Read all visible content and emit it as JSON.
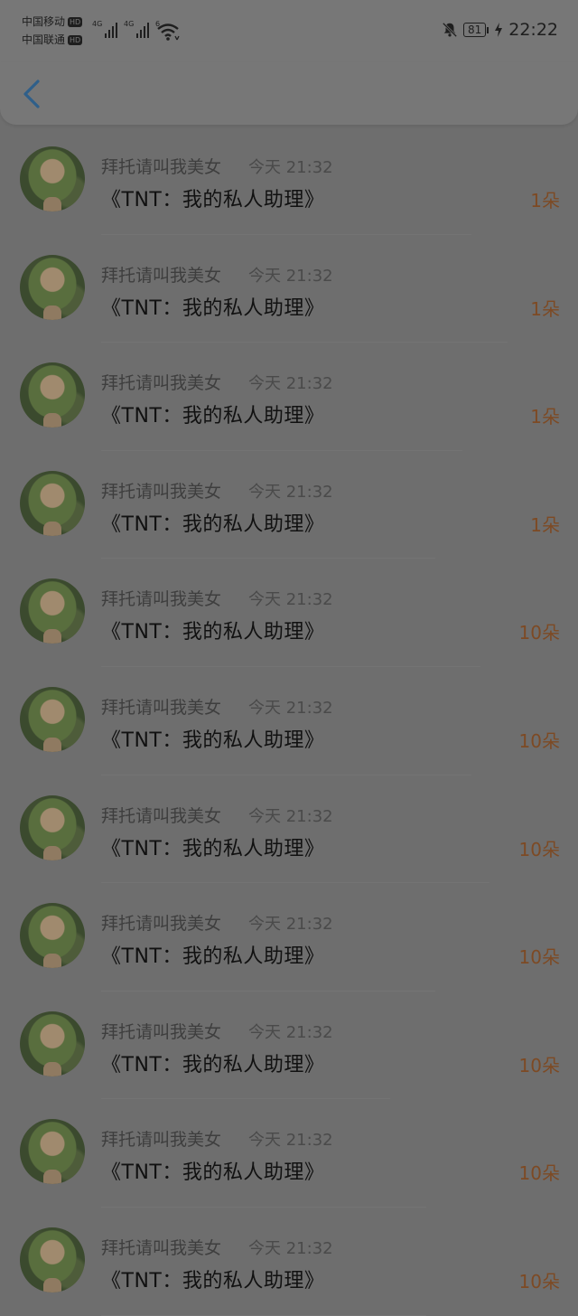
{
  "status_bar": {
    "carrier1": "中国移动",
    "carrier2": "中国联通",
    "hd_badge": "HD",
    "network1": "4G",
    "network2": "4G",
    "wifi_label": "6",
    "battery": "81",
    "time": "22:22"
  },
  "nav": {
    "back_icon": "chevron-left-icon"
  },
  "messages": [
    {
      "name": "拜托请叫我美女",
      "time": "今天 21:32",
      "text": "《TNT：我的私人助理》",
      "amount": "1朵"
    },
    {
      "name": "拜托请叫我美女",
      "time": "今天 21:32",
      "text": "《TNT：我的私人助理》",
      "amount": "1朵"
    },
    {
      "name": "拜托请叫我美女",
      "time": "今天 21:32",
      "text": "《TNT：我的私人助理》",
      "amount": "1朵"
    },
    {
      "name": "拜托请叫我美女",
      "time": "今天 21:32",
      "text": "《TNT：我的私人助理》",
      "amount": "1朵"
    },
    {
      "name": "拜托请叫我美女",
      "time": "今天 21:32",
      "text": "《TNT：我的私人助理》",
      "amount": "10朵"
    },
    {
      "name": "拜托请叫我美女",
      "time": "今天 21:32",
      "text": "《TNT：我的私人助理》",
      "amount": "10朵"
    },
    {
      "name": "拜托请叫我美女",
      "time": "今天 21:32",
      "text": "《TNT：我的私人助理》",
      "amount": "10朵"
    },
    {
      "name": "拜托请叫我美女",
      "time": "今天 21:32",
      "text": "《TNT：我的私人助理》",
      "amount": "10朵"
    },
    {
      "name": "拜托请叫我美女",
      "time": "今天 21:32",
      "text": "《TNT：我的私人助理》",
      "amount": "10朵"
    },
    {
      "name": "拜托请叫我美女",
      "time": "今天 21:32",
      "text": "《TNT：我的私人助理》",
      "amount": "10朵"
    },
    {
      "name": "拜托请叫我美女",
      "time": "今天 21:32",
      "text": "《TNT：我的私人助理》",
      "amount": "10朵"
    }
  ],
  "colors": {
    "accent_back": "#2f5f8a",
    "amount": "#7d4a24"
  }
}
